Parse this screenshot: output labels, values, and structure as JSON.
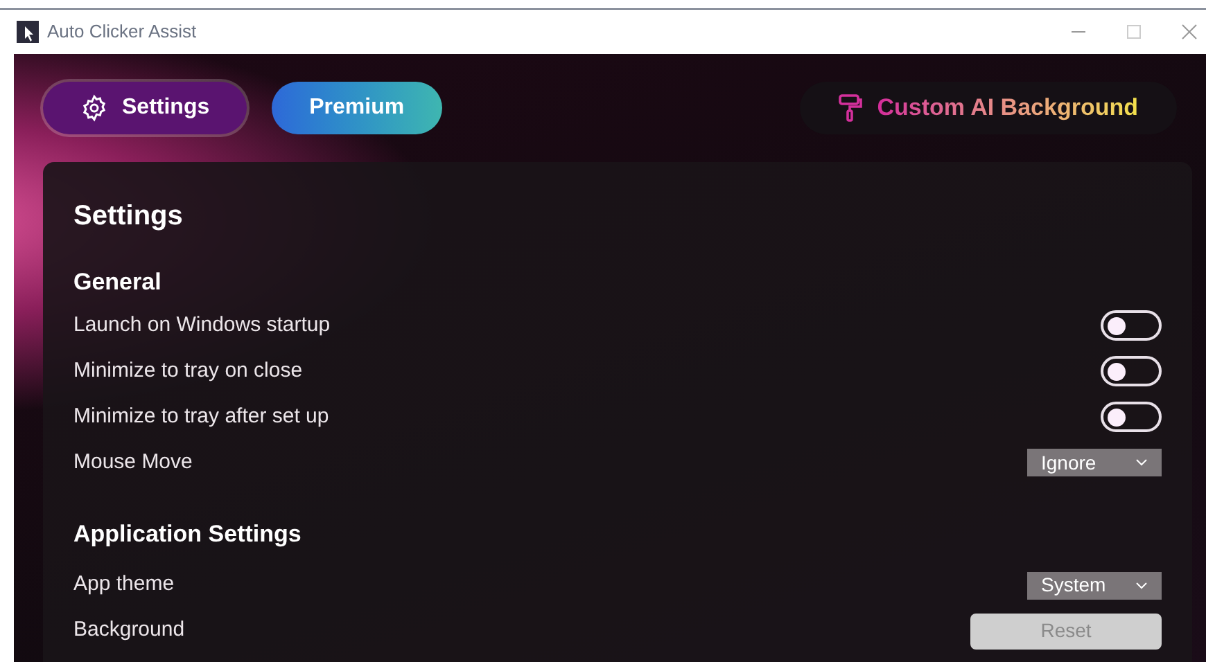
{
  "window": {
    "title": "Auto Clicker Assist"
  },
  "tabs": [
    {
      "label": "Settings",
      "kind": "settings",
      "selected": true
    },
    {
      "label": "Premium",
      "kind": "premium",
      "selected": false
    }
  ],
  "custom_ai_button": {
    "label": "Custom AI Background"
  },
  "panel": {
    "title": "Settings",
    "sections": [
      {
        "title": "General",
        "rows": [
          {
            "kind": "toggle",
            "label": "Launch on Windows startup",
            "on": false
          },
          {
            "kind": "toggle",
            "label": "Minimize to tray on close",
            "on": false
          },
          {
            "kind": "toggle",
            "label": "Minimize to tray after set up",
            "on": false
          },
          {
            "kind": "dropdown",
            "label": "Mouse Move",
            "value": "Ignore"
          }
        ]
      },
      {
        "title": "Application Settings",
        "rows": [
          {
            "kind": "dropdown",
            "label": "App theme",
            "value": "System"
          },
          {
            "kind": "button",
            "label": "Background",
            "button": "Reset"
          }
        ]
      }
    ]
  }
}
